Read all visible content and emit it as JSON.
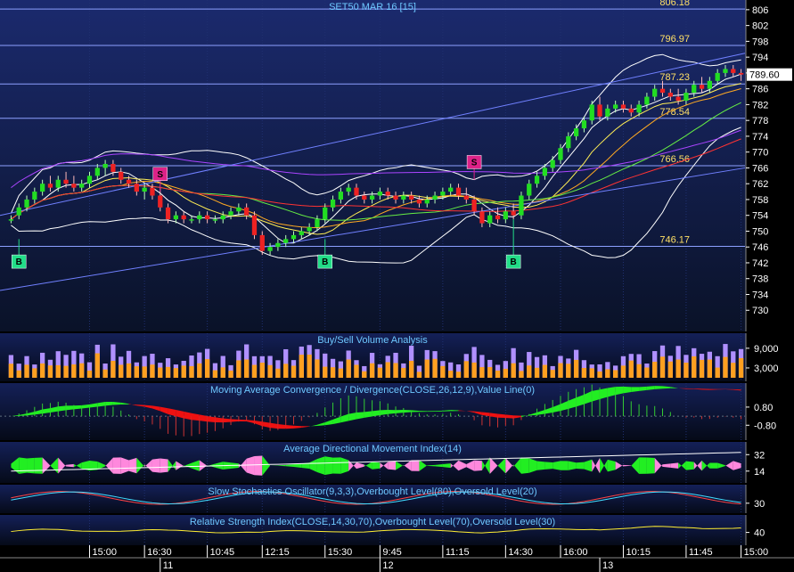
{
  "colors": {
    "background": "#000000",
    "panel_top": "#1b2a6e",
    "panel_bottom": "#0a1228",
    "grid": "#203070",
    "level_line": "#8da0ff",
    "candle_up": "#22dd22",
    "candle_down": "#ee2222",
    "macd_pos": "#22ee22",
    "macd_neg": "#ee1111",
    "adx_pos": "#22ee22",
    "adx_neg": "#ff88dd",
    "buy_marker": "#22dd88",
    "sell_marker": "#dd2288",
    "text_title": "#6ec8ff",
    "text_level": "#ffe066",
    "price_label_bg": "#ffffff"
  },
  "chart_data": [
    {
      "type": "candlestick",
      "title": "SET50 MAR 16   [15]",
      "ylim": [
        726,
        808
      ],
      "y_ticks": [
        806,
        802,
        798,
        794,
        790,
        786,
        782,
        778,
        774,
        770,
        766,
        762,
        758,
        754,
        750,
        746,
        742,
        738,
        734,
        730
      ],
      "last_price": "789.60",
      "levels": [
        {
          "label": "806.18",
          "value": 806.18
        },
        {
          "label": "796.97",
          "value": 796.97
        },
        {
          "label": "787.23",
          "value": 787.23
        },
        {
          "label": "778.54",
          "value": 778.54
        },
        {
          "label": "766.56",
          "value": 766.56
        },
        {
          "label": "746.17",
          "value": 746.17
        }
      ],
      "signals": [
        {
          "type": "B",
          "label": "B",
          "index": 1,
          "price": 748
        },
        {
          "type": "S",
          "label": "S",
          "index": 19,
          "price": 760
        },
        {
          "type": "B",
          "label": "B",
          "index": 40,
          "price": 748
        },
        {
          "type": "S",
          "label": "S",
          "index": 59,
          "price": 763
        },
        {
          "type": "B",
          "label": "B",
          "index": 64,
          "price": 753
        }
      ],
      "x_ticks": [
        {
          "label": "15:00",
          "index": 10
        },
        {
          "label": "16:30",
          "index": 17
        },
        {
          "label": "10:45",
          "index": 25
        },
        {
          "label": "12:15",
          "index": 32
        },
        {
          "label": "15:30",
          "index": 40
        },
        {
          "label": "9:45",
          "index": 47
        },
        {
          "label": "11:15",
          "index": 55
        },
        {
          "label": "14:30",
          "index": 63
        },
        {
          "label": "16:00",
          "index": 70
        },
        {
          "label": "10:15",
          "index": 78
        },
        {
          "label": "11:45",
          "index": 86
        },
        {
          "label": "15:00",
          "index": 93
        }
      ],
      "day_labels": [
        {
          "label": "11",
          "index": 19
        },
        {
          "label": "12",
          "index": 47
        },
        {
          "label": "13",
          "index": 75
        }
      ],
      "candles": [
        [
          753,
          754,
          752,
          753
        ],
        [
          754,
          757,
          753,
          756
        ],
        [
          756,
          759,
          755,
          758
        ],
        [
          758,
          761,
          757,
          760
        ],
        [
          760,
          763,
          759,
          762
        ],
        [
          762,
          764,
          760,
          761
        ],
        [
          761,
          764,
          760,
          763
        ],
        [
          763,
          765,
          761,
          762
        ],
        [
          762,
          764,
          760,
          761
        ],
        [
          761,
          763,
          760,
          762
        ],
        [
          762,
          765,
          761,
          764
        ],
        [
          764,
          767,
          763,
          766
        ],
        [
          766,
          768,
          764,
          767
        ],
        [
          767,
          768,
          764,
          765
        ],
        [
          765,
          766,
          762,
          763
        ],
        [
          763,
          764,
          761,
          762
        ],
        [
          762,
          763,
          759,
          760
        ],
        [
          760,
          762,
          758,
          761
        ],
        [
          761,
          762,
          758,
          759
        ],
        [
          759,
          761,
          755,
          756
        ],
        [
          756,
          757,
          752,
          753
        ],
        [
          753,
          755,
          752,
          754
        ],
        [
          754,
          755,
          752,
          753
        ],
        [
          753,
          754,
          752,
          753
        ],
        [
          753,
          755,
          752,
          754
        ],
        [
          754,
          755,
          752,
          753
        ],
        [
          753,
          754,
          752,
          753
        ],
        [
          753,
          755,
          752,
          754
        ],
        [
          754,
          756,
          753,
          755
        ],
        [
          755,
          757,
          754,
          756
        ],
        [
          756,
          757,
          753,
          754
        ],
        [
          754,
          755,
          748,
          749
        ],
        [
          749,
          750,
          744,
          745
        ],
        [
          745,
          747,
          744,
          746
        ],
        [
          746,
          748,
          745,
          747
        ],
        [
          747,
          749,
          746,
          748
        ],
        [
          748,
          750,
          747,
          749
        ],
        [
          749,
          751,
          748,
          750
        ],
        [
          750,
          752,
          749,
          751
        ],
        [
          751,
          754,
          750,
          753
        ],
        [
          753,
          757,
          752,
          756
        ],
        [
          756,
          759,
          755,
          758
        ],
        [
          758,
          761,
          757,
          760
        ],
        [
          760,
          762,
          759,
          761
        ],
        [
          761,
          762,
          758,
          759
        ],
        [
          759,
          760,
          757,
          758
        ],
        [
          758,
          760,
          757,
          759
        ],
        [
          759,
          761,
          758,
          760
        ],
        [
          760,
          761,
          758,
          759
        ],
        [
          759,
          760,
          757,
          758
        ],
        [
          758,
          760,
          757,
          759
        ],
        [
          759,
          760,
          757,
          758
        ],
        [
          758,
          759,
          756,
          757
        ],
        [
          757,
          759,
          756,
          758
        ],
        [
          758,
          760,
          757,
          759
        ],
        [
          759,
          761,
          758,
          760
        ],
        [
          760,
          762,
          759,
          761
        ],
        [
          761,
          762,
          758,
          759
        ],
        [
          759,
          761,
          757,
          758
        ],
        [
          758,
          759,
          754,
          755
        ],
        [
          755,
          756,
          751,
          752
        ],
        [
          752,
          755,
          751,
          754
        ],
        [
          754,
          756,
          752,
          753
        ],
        [
          753,
          756,
          752,
          755
        ],
        [
          755,
          757,
          753,
          754
        ],
        [
          754,
          760,
          753,
          759
        ],
        [
          759,
          763,
          758,
          762
        ],
        [
          762,
          765,
          761,
          764
        ],
        [
          764,
          767,
          763,
          766
        ],
        [
          766,
          769,
          765,
          768
        ],
        [
          768,
          772,
          767,
          771
        ],
        [
          771,
          775,
          770,
          774
        ],
        [
          774,
          777,
          773,
          776
        ],
        [
          776,
          779,
          775,
          778
        ],
        [
          778,
          783,
          777,
          782
        ],
        [
          782,
          784,
          778,
          779
        ],
        [
          779,
          782,
          778,
          781
        ],
        [
          781,
          783,
          780,
          782
        ],
        [
          782,
          783,
          780,
          781
        ],
        [
          781,
          782,
          779,
          780
        ],
        [
          780,
          783,
          779,
          782
        ],
        [
          782,
          785,
          781,
          784
        ],
        [
          784,
          787,
          783,
          786
        ],
        [
          786,
          788,
          784,
          785
        ],
        [
          785,
          786,
          783,
          784
        ],
        [
          784,
          786,
          782,
          783
        ],
        [
          783,
          786,
          782,
          785
        ],
        [
          785,
          788,
          784,
          787
        ],
        [
          787,
          789,
          785,
          786
        ],
        [
          786,
          789,
          785,
          788
        ],
        [
          788,
          791,
          787,
          790
        ],
        [
          790,
          792,
          789,
          791
        ],
        [
          791,
          792,
          789,
          790
        ],
        [
          790,
          791,
          788,
          789.6
        ]
      ]
    },
    {
      "type": "bar",
      "title": "Buy/Sell Volume Analysis",
      "ylim": [
        0,
        12500
      ],
      "y_ticks": [
        {
          "label": "9,000",
          "value": 9000
        },
        {
          "label": "3,000",
          "value": 3000
        }
      ]
    },
    {
      "type": "area",
      "title": "Moving Average Convergence / Divergence(CLOSE,26,12,9),Value Line(0)",
      "ylim": [
        -1.8,
        2.6
      ],
      "y_ticks": [
        {
          "label": "0.80",
          "value": 0.8
        },
        {
          "label": "-0.80",
          "value": -0.8
        }
      ]
    },
    {
      "type": "area",
      "title": "Average Directional Movement Index(14)",
      "ylim": [
        5,
        42
      ],
      "y_ticks": [
        {
          "label": "32",
          "value": 32
        },
        {
          "label": "14",
          "value": 14
        }
      ]
    },
    {
      "type": "line",
      "title": "Slow Stochastics Oscillator(9,3,3),Overbought Level(80),Oversold Level(20)",
      "ylim": [
        0,
        100
      ],
      "y_ticks": [
        {
          "label": "30",
          "value": 30
        }
      ]
    },
    {
      "type": "line",
      "title": "Relative Strength Index(CLOSE,14,30,70),Overbought Level(70),Oversold Level(30)",
      "ylim": [
        0,
        100
      ],
      "y_ticks": [
        {
          "label": "40",
          "value": 40
        }
      ]
    }
  ]
}
